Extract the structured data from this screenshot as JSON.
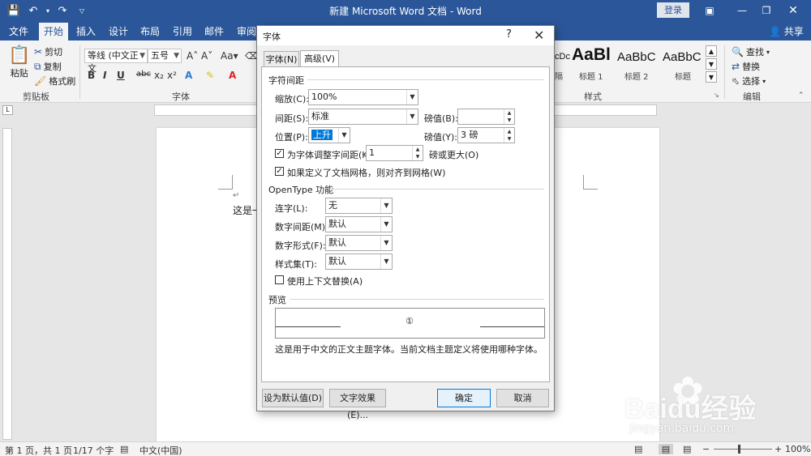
{
  "window": {
    "title": "新建 Microsoft Word 文档 - Word",
    "login": "登录",
    "share": "共享"
  },
  "ribbon_tabs": [
    "文件",
    "开始",
    "插入",
    "设计",
    "布局",
    "引用",
    "邮件",
    "审阅"
  ],
  "ribbon": {
    "clipboard": {
      "paste": "粘贴",
      "cut": "剪切",
      "copy": "复制",
      "format_painter": "格式刷",
      "group": "剪贴板"
    },
    "font": {
      "name": "等线 (中文正文",
      "size": "五号",
      "group": "字体"
    },
    "styles": {
      "items": [
        {
          "preview": "AaBl",
          "name": "标题 1"
        },
        {
          "preview": "AaBbC",
          "name": "标题 2"
        },
        {
          "preview": "AaBbC",
          "name": "标题"
        }
      ],
      "partial_preview": "cDc",
      "partial_name": "隔",
      "group": "样式"
    },
    "editing": {
      "find": "查找",
      "replace": "替换",
      "select": "选择",
      "group": "编辑"
    }
  },
  "document": {
    "text": "这是一"
  },
  "statusbar": {
    "page": "第 1 页，共 1 页",
    "words": "1/17 个字",
    "language": "中文(中国)",
    "zoom": "100%"
  },
  "dialog": {
    "title": "字体",
    "help": "?",
    "tabs": [
      "字体(N)",
      "高级(V)"
    ],
    "spacing_section": "字符间距",
    "scale_label": "缩放(C):",
    "scale_value": "100%",
    "spacing_label": "间距(S):",
    "spacing_value": "标准",
    "spacing_by_label": "磅值(B):",
    "spacing_by_value": "",
    "position_label": "位置(P):",
    "position_value": "上升",
    "position_by_label": "磅值(Y):",
    "position_by_value": "3 磅",
    "kerning_label": "为字体调整字间距(K):",
    "kerning_value": "1",
    "kerning_suffix": "磅或更大(O)",
    "grid_label": "如果定义了文档网格，则对齐到网格(W)",
    "opentype_section": "OpenType 功能",
    "ligatures_label": "连字(L):",
    "ligatures_value": "无",
    "num_spacing_label": "数字间距(M):",
    "num_spacing_value": "默认",
    "num_forms_label": "数字形式(F):",
    "num_forms_value": "默认",
    "stylistic_label": "样式集(T):",
    "stylistic_value": "默认",
    "contextual_label": "使用上下文替换(A)",
    "preview_section": "预览",
    "preview_glyph": "①",
    "preview_desc": "这是用于中文的正文主题字体。当前文档主题定义将使用哪种字体。",
    "btn_default": "设为默认值(D)",
    "btn_effects": "文字效果(E)...",
    "btn_ok": "确定",
    "btn_cancel": "取消"
  },
  "watermark": {
    "brand": "Baidu经验",
    "url": "jingyan.baidu.com"
  }
}
